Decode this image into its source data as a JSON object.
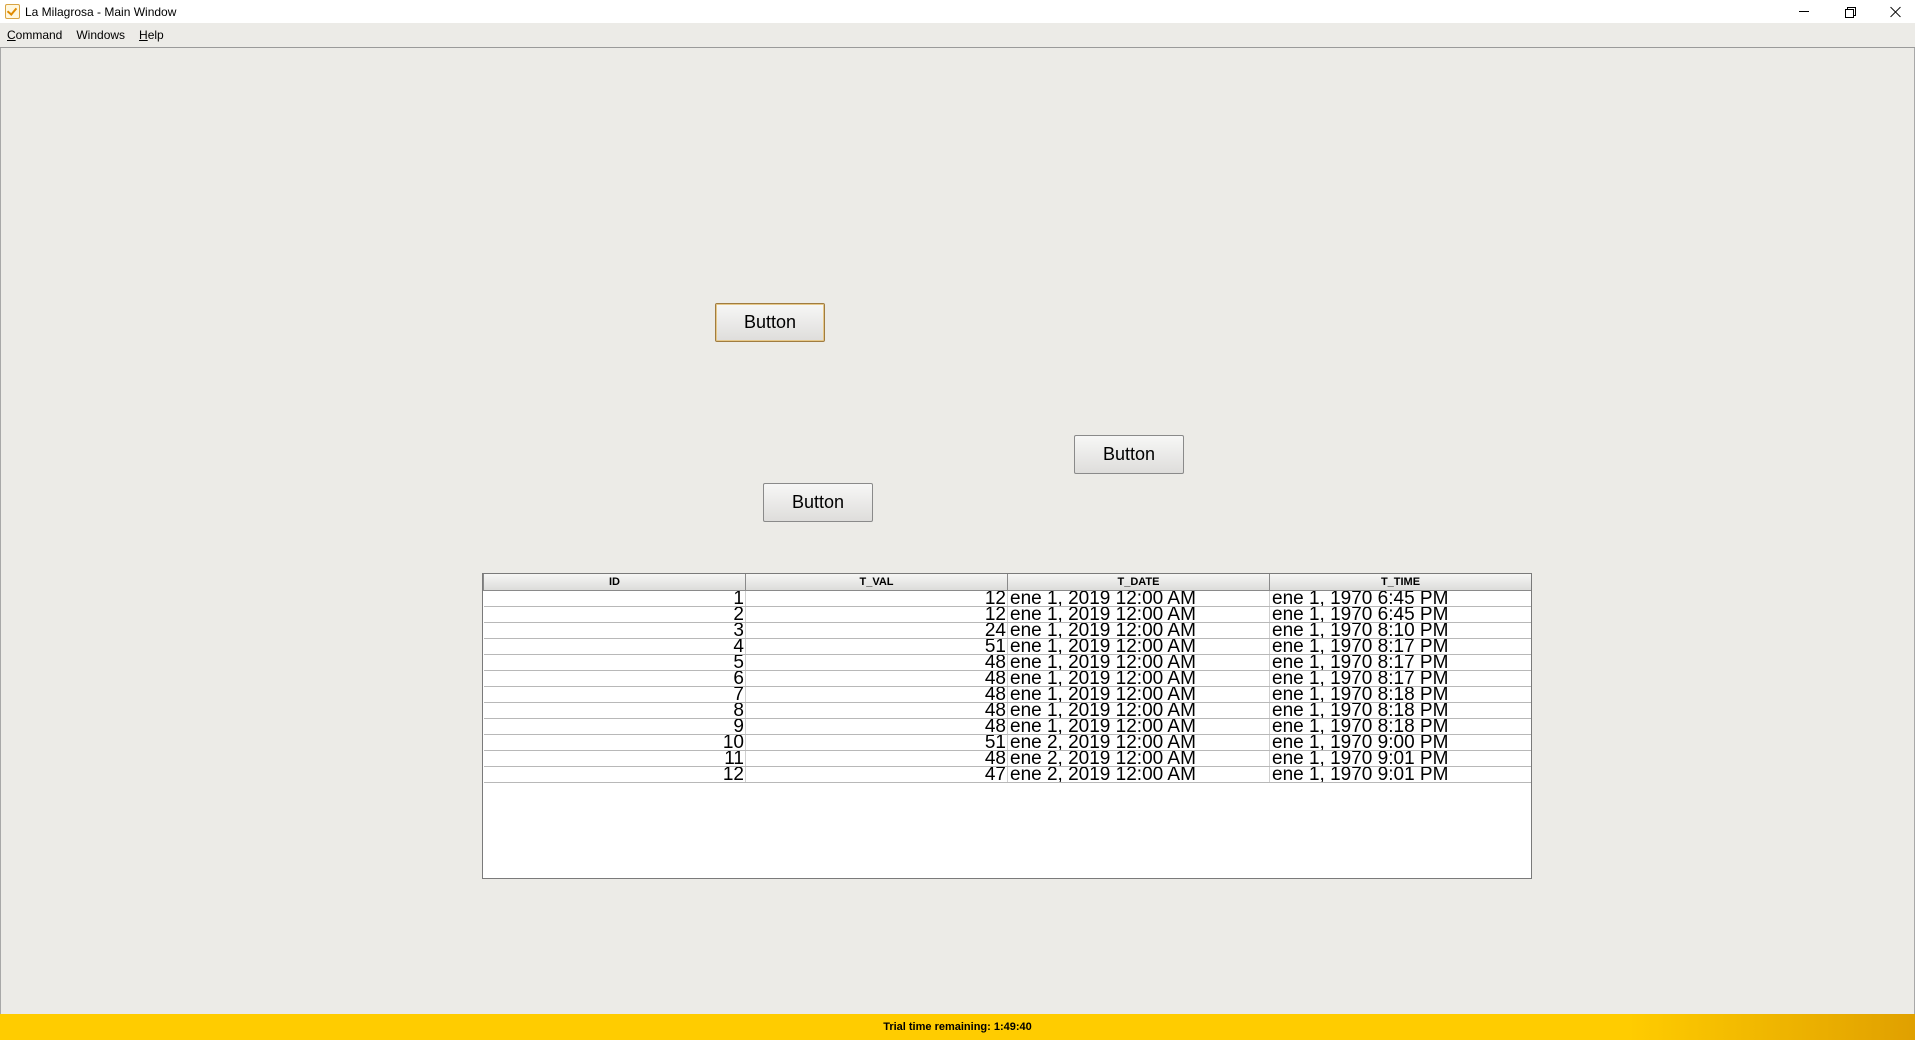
{
  "window": {
    "title": "La Milagrosa - Main Window",
    "icons": [
      "app-icon",
      "minimize-icon",
      "restore-icon",
      "close-icon"
    ]
  },
  "menubar": {
    "items": [
      {
        "label": "Command",
        "mnemonic_first": "C",
        "rest": "ommand"
      },
      {
        "label": "Windows",
        "mnemonic_first": "",
        "rest": "Windows"
      },
      {
        "label": "Help",
        "mnemonic_first": "H",
        "rest": "elp"
      }
    ]
  },
  "buttons": [
    {
      "label": "Button",
      "focused": true
    },
    {
      "label": "Button",
      "focused": false
    },
    {
      "label": "Button",
      "focused": false
    }
  ],
  "table": {
    "columns": [
      "ID",
      "T_VAL",
      "T_DATE",
      "T_TIME"
    ],
    "rows": [
      [
        "1",
        "12",
        "ene 1, 2019 12:00 AM",
        "ene 1, 1970 6:45 PM"
      ],
      [
        "2",
        "12",
        "ene 1, 2019 12:00 AM",
        "ene 1, 1970 6:45 PM"
      ],
      [
        "3",
        "24",
        "ene 1, 2019 12:00 AM",
        "ene 1, 1970 8:10 PM"
      ],
      [
        "4",
        "51",
        "ene 1, 2019 12:00 AM",
        "ene 1, 1970 8:17 PM"
      ],
      [
        "5",
        "48",
        "ene 1, 2019 12:00 AM",
        "ene 1, 1970 8:17 PM"
      ],
      [
        "6",
        "48",
        "ene 1, 2019 12:00 AM",
        "ene 1, 1970 8:17 PM"
      ],
      [
        "7",
        "48",
        "ene 1, 2019 12:00 AM",
        "ene 1, 1970 8:18 PM"
      ],
      [
        "8",
        "48",
        "ene 1, 2019 12:00 AM",
        "ene 1, 1970 8:18 PM"
      ],
      [
        "9",
        "48",
        "ene 1, 2019 12:00 AM",
        "ene 1, 1970 8:18 PM"
      ],
      [
        "10",
        "51",
        "ene 2, 2019 12:00 AM",
        "ene 1, 1970 9:00 PM"
      ],
      [
        "11",
        "48",
        "ene 2, 2019 12:00 AM",
        "ene 1, 1970 9:01 PM"
      ],
      [
        "12",
        "47",
        "ene 2, 2019 12:00 AM",
        "ene 1, 1970 9:01 PM"
      ]
    ]
  },
  "status": {
    "text": "Trial time remaining: 1:49:40",
    "color": "#ffcc00"
  }
}
